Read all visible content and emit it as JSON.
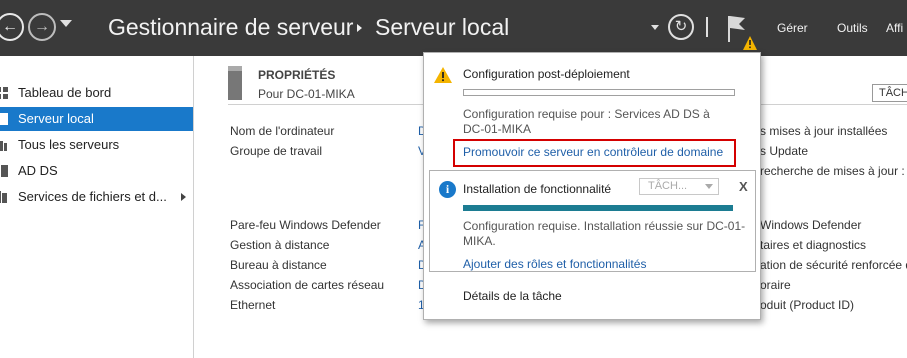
{
  "header": {
    "breadcrumb_root": "Gestionnaire de serveur",
    "breadcrumb_current": "Serveur local",
    "menu": {
      "manage": "Gérer",
      "tools": "Outils",
      "view": "Affi"
    }
  },
  "sidebar": {
    "items": [
      {
        "label": "Tableau de bord"
      },
      {
        "label": "Serveur local"
      },
      {
        "label": "Tous les serveurs"
      },
      {
        "label": "AD DS"
      },
      {
        "label": "Services de fichiers et d..."
      }
    ]
  },
  "properties": {
    "title": "PROPRIÉTÉS",
    "subtitle": "Pour DC-01-MIKA",
    "tasks_label": "TÂCH",
    "labels": [
      "Nom de l'ordinateur",
      "Groupe de travail",
      "Pare-feu Windows Defender",
      "Gestion à distance",
      "Bureau à distance",
      "Association de cartes réseau",
      "Ethernet"
    ],
    "values_partial": [
      "D",
      "V",
      "F",
      "A",
      "D",
      "D",
      "1"
    ],
    "right_partial": [
      "s mises à jour installées",
      "s Update",
      "recherche de mises à jour :",
      "Windows Defender",
      "taires et diagnostics",
      "ation de sécurité renforcée de",
      "oraire",
      "oduit (Product ID)"
    ]
  },
  "notifications": {
    "post_deploy_title": "Configuration post-déploiement",
    "post_deploy_message": "Configuration requise pour : Services AD DS à DC-01-MIKA",
    "promote_link": "Promouvoir ce serveur en contrôleur de domaine",
    "feature_install_title": "Installation de fonctionnalité",
    "task_select": "TÂCH...",
    "close": "X",
    "feature_install_message": "Configuration requise. Installation réussie sur DC-01-MIKA.",
    "add_roles_link": "Ajouter des rôles et fonctionnalités",
    "task_details": "Détails de la tâche"
  },
  "colors": {
    "titlebar": "#3a3a3a",
    "selection": "#1979ca",
    "highlight_border": "#d40000",
    "progress_fill": "#1c7c92"
  }
}
